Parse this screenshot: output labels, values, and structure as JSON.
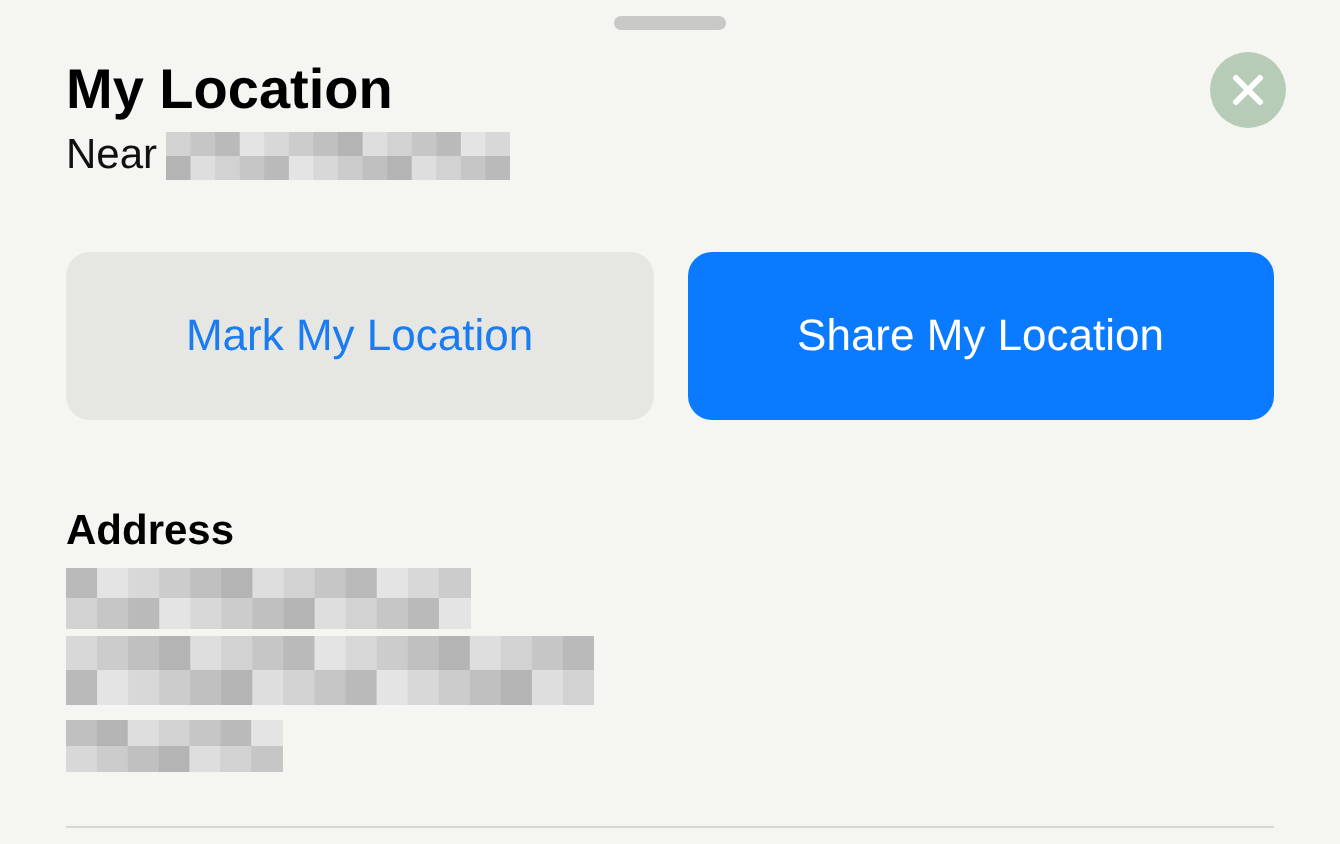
{
  "sheet": {
    "title": "My Location",
    "subtitle": "Near"
  },
  "actions": [
    {
      "label": "Mark My Location",
      "kind": "secondary"
    },
    {
      "label": "Share My Location",
      "kind": "primary"
    }
  ],
  "address": {
    "heading": "Address"
  }
}
